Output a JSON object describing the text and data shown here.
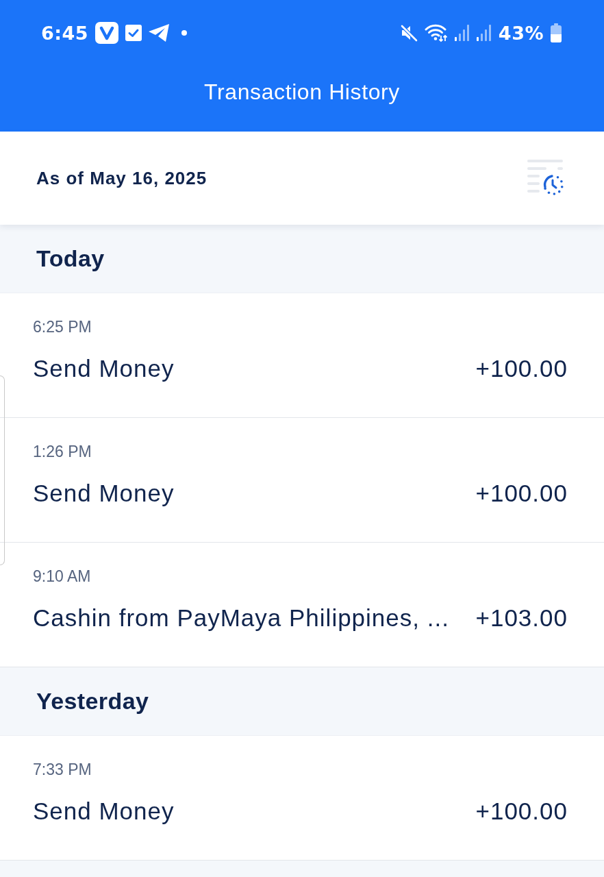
{
  "status_bar": {
    "time": "6:45",
    "battery": "43%"
  },
  "header": {
    "title": "Transaction History"
  },
  "summary": {
    "as_of": "As of May 16, 2025"
  },
  "sections": [
    {
      "label": "Today",
      "transactions": [
        {
          "time": "6:25 PM",
          "description": "Send Money",
          "amount": "+100.00"
        },
        {
          "time": "1:26 PM",
          "description": "Send Money",
          "amount": "+100.00"
        },
        {
          "time": "9:10 AM",
          "description": "Cashin from PayMaya Philippines, ...",
          "amount": "+103.00"
        }
      ]
    },
    {
      "label": "Yesterday",
      "transactions": [
        {
          "time": "7:33 PM",
          "description": "Send Money",
          "amount": "+100.00"
        }
      ]
    }
  ]
}
